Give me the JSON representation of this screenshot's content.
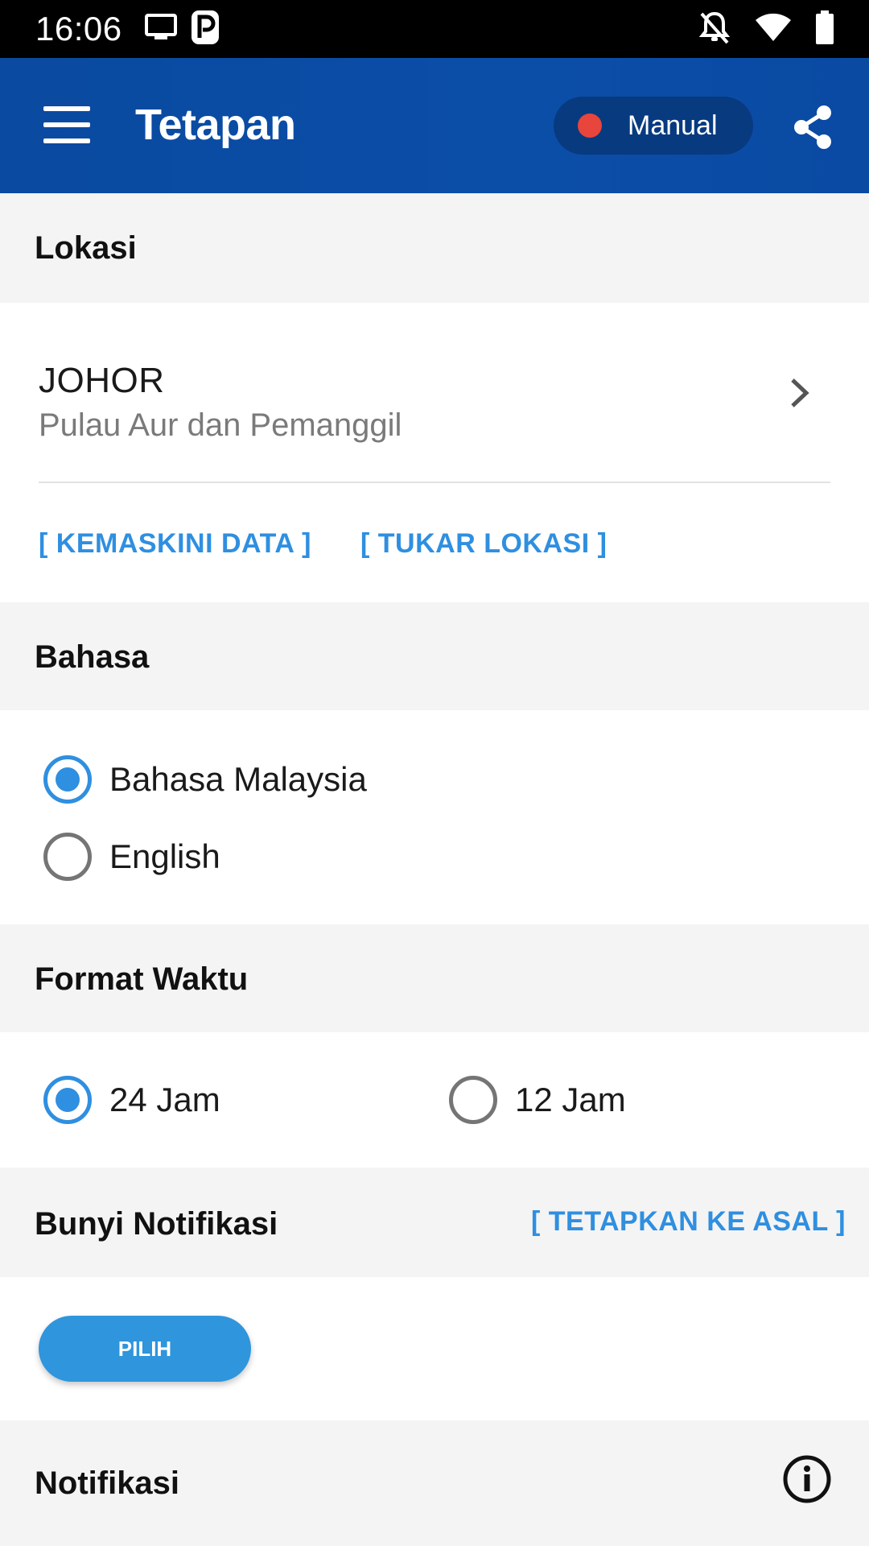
{
  "status_bar": {
    "time": "16:06",
    "icons": [
      "screen-cast-icon",
      "parking-app-icon",
      "notifications-off-icon",
      "wifi-icon",
      "battery-icon"
    ]
  },
  "app_bar": {
    "title": "Tetapan",
    "mode_label": "Manual",
    "mode_dot_color": "#e8453c",
    "background_color": "#0b4ea8"
  },
  "location": {
    "header": "Lokasi",
    "state": "JOHOR",
    "zone": "Pulau Aur dan Pemanggil",
    "update_link": "[ KEMASKINI DATA ]",
    "change_link": "[ TUKAR LOKASI ]"
  },
  "language": {
    "header": "Bahasa",
    "options": [
      {
        "label": "Bahasa Malaysia",
        "selected": true
      },
      {
        "label": "English",
        "selected": false
      }
    ]
  },
  "time_format": {
    "header": "Format Waktu",
    "options": [
      {
        "label": "24 Jam",
        "selected": true
      },
      {
        "label": "12 Jam",
        "selected": false
      }
    ]
  },
  "notification_sound": {
    "header": "Bunyi Notifikasi",
    "reset_link": "[ TETAPKAN KE ASAL ]",
    "pick_button": "PILIH"
  },
  "notifications": {
    "header": "Notifikasi"
  },
  "colors": {
    "accent": "#2f8fe0",
    "section_bg": "#f4f4f4"
  }
}
